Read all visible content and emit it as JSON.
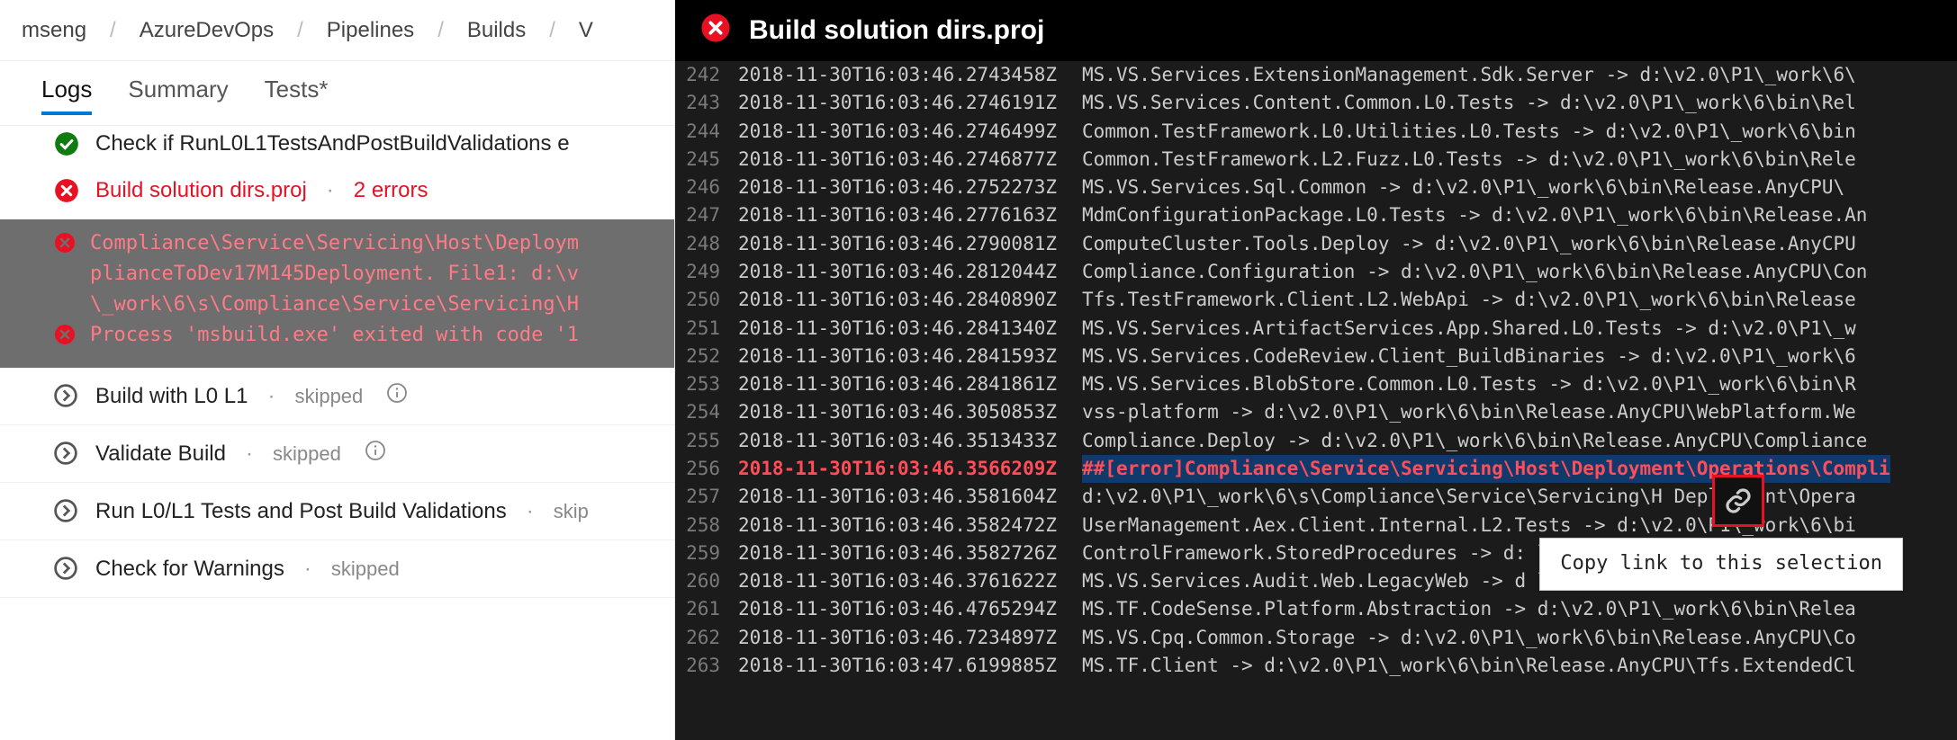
{
  "breadcrumbs": {
    "items": [
      "mseng",
      "AzureDevOps",
      "Pipelines",
      "Builds",
      "V"
    ]
  },
  "view_tabs": {
    "items": [
      {
        "label": "Logs",
        "active": true
      },
      {
        "label": "Summary",
        "active": false
      },
      {
        "label": "Tests*",
        "active": false
      }
    ]
  },
  "steps": {
    "previous_partial": "Check if RunL0L1TestsAndPostBuildValidations e",
    "failed": {
      "title": "Build solution dirs.proj",
      "error_count": "2 errors",
      "errors": [
        "Compliance\\Service\\Servicing\\Host\\Deploym\nplianceToDev17M145Deployment. File1: d:\\v\n\\_work\\6\\s\\Compliance\\Service\\Servicing\\H",
        "Process 'msbuild.exe' exited with code '1"
      ]
    },
    "skipped": [
      {
        "title": "Build with L0 L1",
        "status": "skipped"
      },
      {
        "title": "Validate Build",
        "status": "skipped"
      },
      {
        "title": "Run L0/L1 Tests and Post Build Validations",
        "status": "skip"
      },
      {
        "title": "Check for Warnings",
        "status": "skipped"
      }
    ]
  },
  "log_panel": {
    "title": "Build solution dirs.proj",
    "copy_link_tooltip": "Copy link to this selection",
    "lines": [
      {
        "n": 242,
        "ts": "2018-11-30T16:03:46.2743458Z",
        "msg": "MS.VS.Services.ExtensionManagement.Sdk.Server -> d:\\v2.0\\P1\\_work\\6\\"
      },
      {
        "n": 243,
        "ts": "2018-11-30T16:03:46.2746191Z",
        "msg": "MS.VS.Services.Content.Common.L0.Tests -> d:\\v2.0\\P1\\_work\\6\\bin\\Rel"
      },
      {
        "n": 244,
        "ts": "2018-11-30T16:03:46.2746499Z",
        "msg": "Common.TestFramework.L0.Utilities.L0.Tests -> d:\\v2.0\\P1\\_work\\6\\bin"
      },
      {
        "n": 245,
        "ts": "2018-11-30T16:03:46.2746877Z",
        "msg": "Common.TestFramework.L2.Fuzz.L0.Tests -> d:\\v2.0\\P1\\_work\\6\\bin\\Rele"
      },
      {
        "n": 246,
        "ts": "2018-11-30T16:03:46.2752273Z",
        "msg": "MS.VS.Services.Sql.Common -> d:\\v2.0\\P1\\_work\\6\\bin\\Release.AnyCPU\\"
      },
      {
        "n": 247,
        "ts": "2018-11-30T16:03:46.2776163Z",
        "msg": "MdmConfigurationPackage.L0.Tests -> d:\\v2.0\\P1\\_work\\6\\bin\\Release.An"
      },
      {
        "n": 248,
        "ts": "2018-11-30T16:03:46.2790081Z",
        "msg": "ComputeCluster.Tools.Deploy -> d:\\v2.0\\P1\\_work\\6\\bin\\Release.AnyCPU"
      },
      {
        "n": 249,
        "ts": "2018-11-30T16:03:46.2812044Z",
        "msg": "Compliance.Configuration -> d:\\v2.0\\P1\\_work\\6\\bin\\Release.AnyCPU\\Con"
      },
      {
        "n": 250,
        "ts": "2018-11-30T16:03:46.2840890Z",
        "msg": "Tfs.TestFramework.Client.L2.WebApi -> d:\\v2.0\\P1\\_work\\6\\bin\\Release"
      },
      {
        "n": 251,
        "ts": "2018-11-30T16:03:46.2841340Z",
        "msg": "MS.VS.Services.ArtifactServices.App.Shared.L0.Tests -> d:\\v2.0\\P1\\_w"
      },
      {
        "n": 252,
        "ts": "2018-11-30T16:03:46.2841593Z",
        "msg": "MS.VS.Services.CodeReview.Client_BuildBinaries -> d:\\v2.0\\P1\\_work\\6"
      },
      {
        "n": 253,
        "ts": "2018-11-30T16:03:46.2841861Z",
        "msg": "MS.VS.Services.BlobStore.Common.L0.Tests -> d:\\v2.0\\P1\\_work\\6\\bin\\R"
      },
      {
        "n": 254,
        "ts": "2018-11-30T16:03:46.3050853Z",
        "msg": "vss-platform -> d:\\v2.0\\P1\\_work\\6\\bin\\Release.AnyCPU\\WebPlatform.We"
      },
      {
        "n": 255,
        "ts": "2018-11-30T16:03:46.3513433Z",
        "msg": "Compliance.Deploy -> d:\\v2.0\\P1\\_work\\6\\bin\\Release.AnyCPU\\Compliance"
      },
      {
        "n": 256,
        "ts": "2018-11-30T16:03:46.3566209Z",
        "msg": "##[error]Compliance\\Service\\Servicing\\Host\\Deployment\\Operations\\Compli",
        "err": true
      },
      {
        "n": 257,
        "ts": "2018-11-30T16:03:46.3581604Z",
        "msg": "d:\\v2.0\\P1\\_work\\6\\s\\Compliance\\Service\\Servicing\\H   Deployment\\Opera"
      },
      {
        "n": 258,
        "ts": "2018-11-30T16:03:46.3582472Z",
        "msg": "UserManagement.Aex.Client.Internal.L2.Tests -> d:\\v2.0\\P1\\_work\\6\\bi"
      },
      {
        "n": 259,
        "ts": "2018-11-30T16:03:46.3582726Z",
        "msg": "ControlFramework.StoredProcedures -> d:                        lease."
      },
      {
        "n": 260,
        "ts": "2018-11-30T16:03:46.3761622Z",
        "msg": "MS.VS.Services.Audit.Web.LegacyWeb -> d                        lease."
      },
      {
        "n": 261,
        "ts": "2018-11-30T16:03:46.4765294Z",
        "msg": "MS.TF.CodeSense.Platform.Abstraction -> d:\\v2.0\\P1\\_work\\6\\bin\\Relea"
      },
      {
        "n": 262,
        "ts": "2018-11-30T16:03:46.7234897Z",
        "msg": "MS.VS.Cpq.Common.Storage -> d:\\v2.0\\P1\\_work\\6\\bin\\Release.AnyCPU\\Co"
      },
      {
        "n": 263,
        "ts": "2018-11-30T16:03:47.6199885Z",
        "msg": "MS.TF.Client -> d:\\v2.0\\P1\\_work\\6\\bin\\Release.AnyCPU\\Tfs.ExtendedCl"
      }
    ]
  },
  "colors": {
    "error": "#E81123",
    "accent": "#0078D4",
    "success": "#107C10"
  }
}
